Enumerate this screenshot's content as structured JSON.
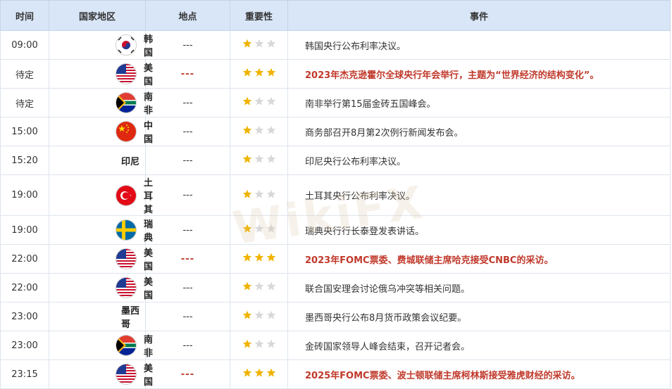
{
  "header": {
    "time": "时间",
    "country": "国家地区",
    "location": "地点",
    "importance": "重要性",
    "event": "事件"
  },
  "rows": [
    {
      "time": "09:00",
      "country": "韩国",
      "flag": "kr",
      "location": "---",
      "stars": 1,
      "event": "韩国央行公布利率决议。",
      "important": false
    },
    {
      "time": "待定",
      "country": "美国",
      "flag": "us",
      "location": "---",
      "stars": 3,
      "event": "2023年杰克逊霍尔全球央行年会举行，主题为“世界经济的结构变化”。",
      "important": true
    },
    {
      "time": "待定",
      "country": "南非",
      "flag": "za",
      "location": "---",
      "stars": 1,
      "event": "南非举行第15届金砖五国峰会。",
      "important": false
    },
    {
      "time": "15:00",
      "country": "中国",
      "flag": "cn",
      "location": "---",
      "stars": 1,
      "event": "商务部召开8月第2次例行新闻发布会。",
      "important": false
    },
    {
      "time": "15:20",
      "country": "印尼",
      "flag": "",
      "location": "---",
      "stars": 1,
      "event": "印尼央行公布利率决议。",
      "important": false
    },
    {
      "time": "19:00",
      "country": "土耳其",
      "flag": "tr",
      "location": "---",
      "stars": 1,
      "event": "土耳其央行公布利率决议。",
      "important": false
    },
    {
      "time": "19:00",
      "country": "瑞典",
      "flag": "se",
      "location": "---",
      "stars": 1,
      "event": "瑞典央行行长泰登发表讲话。",
      "important": false
    },
    {
      "time": "22:00",
      "country": "美国",
      "flag": "us",
      "location": "---",
      "stars": 3,
      "event": "2023年FOMC票委、费城联储主席哈克接受CNBC的采访。",
      "important": true
    },
    {
      "time": "22:00",
      "country": "美国",
      "flag": "us",
      "location": "---",
      "stars": 1,
      "event": "联合国安理会讨论俄乌冲突等相关问题。",
      "important": false
    },
    {
      "time": "23:00",
      "country": "墨西哥",
      "flag": "",
      "location": "---",
      "stars": 1,
      "event": "墨西哥央行公布8月货币政策会议纪要。",
      "important": false
    },
    {
      "time": "23:00",
      "country": "南非",
      "flag": "za",
      "location": "---",
      "stars": 1,
      "event": "金砖国家领导人峰会结束，召开记者会。",
      "important": false
    },
    {
      "time": "23:15",
      "country": "美国",
      "flag": "us",
      "location": "---",
      "stars": 3,
      "event": "2025年FOMC票委、波士顿联储主席柯林斯接受雅虎财经的采访。",
      "important": true
    }
  ],
  "colors": {
    "header_bg": "#d9e6f7",
    "important_text": "#c0392b",
    "star_on": "#f0b400",
    "star_off": "#d8d8d8"
  },
  "watermark": {
    "text": "WikiFX"
  }
}
